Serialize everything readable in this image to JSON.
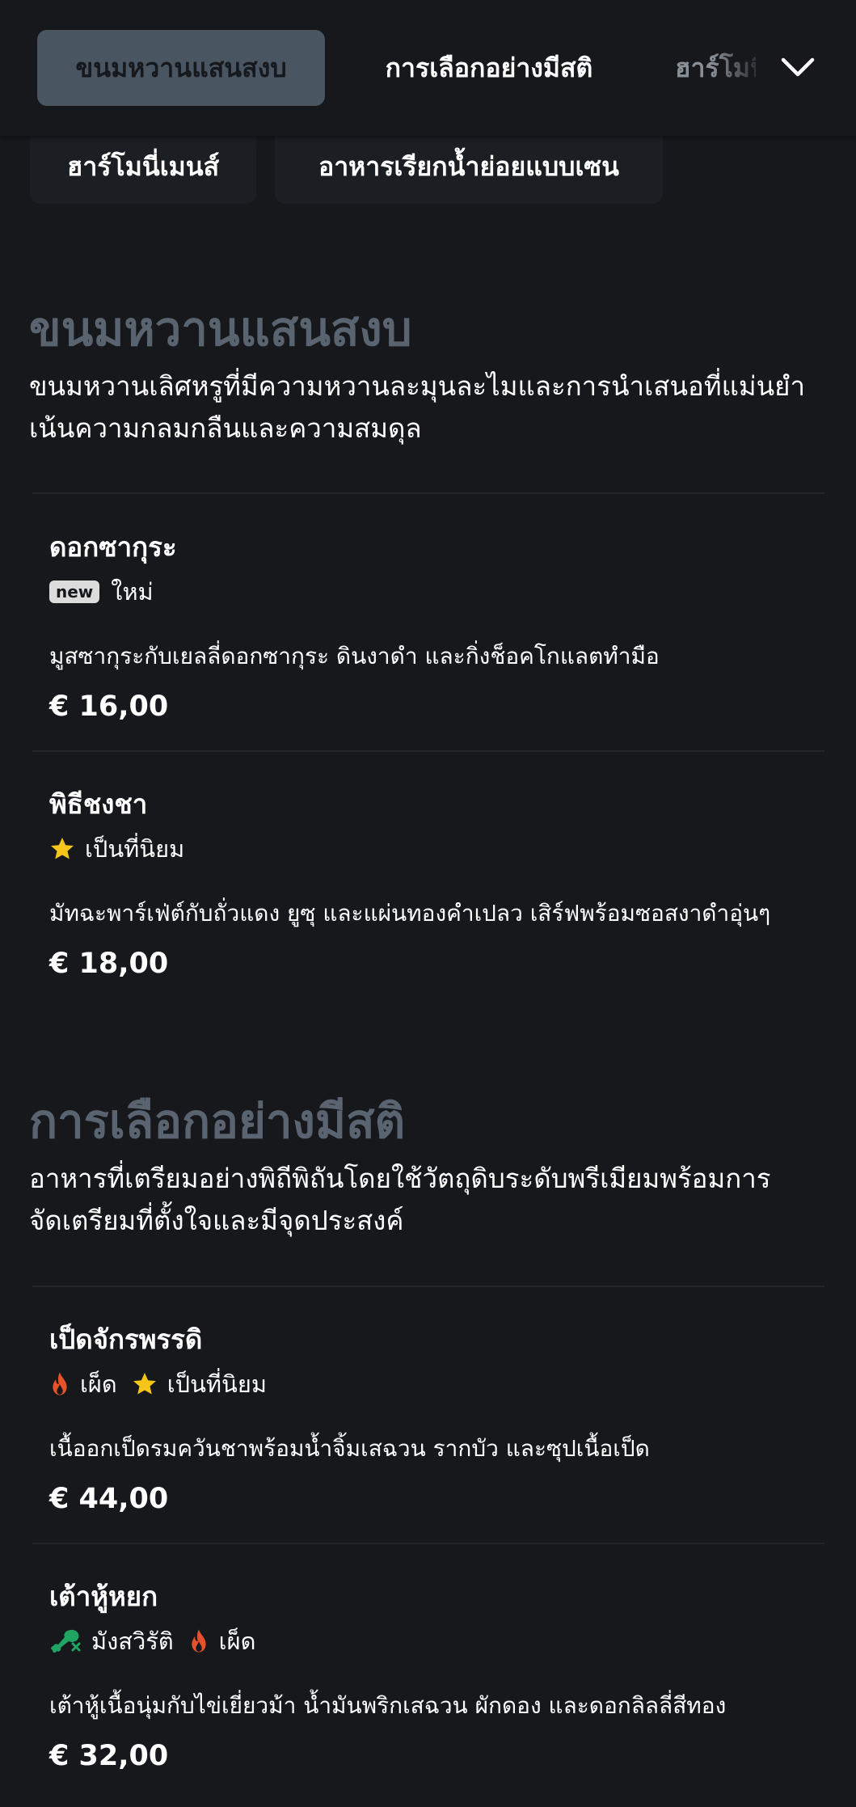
{
  "nav": {
    "tabs": [
      {
        "label": "ขนมหวานแสนสงบ"
      },
      {
        "label": "การเลือกอย่างมีสติ"
      },
      {
        "label": "ฮาร์โมนี่เมนส์"
      }
    ],
    "chips": [
      {
        "label": "ฮาร์โมนี่เมนส์"
      },
      {
        "label": "อาหารเรียกน้ำย่อยแบบเซน"
      }
    ]
  },
  "sections": [
    {
      "title": "ขนมหวานแสนสงบ",
      "desc_line1": "ขนมหวานเลิศหรูที่มีความหวานละมุนละไมและการนำเสนอที่แม่นยำ",
      "desc_line2": "เน้นความกลมกลืนและความสมดุล",
      "items": [
        {
          "name": "ดอกซากุระ",
          "badge": "new",
          "tag_new": "ใหม่",
          "description": "มูสซากุระกับเยลลี่ดอกซากุระ ดินงาดำ และกิ่งช็อคโกแลตทำมือ",
          "price": "€ 16,00"
        },
        {
          "name": "พิธีชงชา",
          "tag_popular": "เป็นที่นิยม",
          "description": "มัทฉะพาร์เฟ่ต์กับถั่วแดง ยูซุ และแผ่นทองคำเปลว เสิร์ฟพร้อมซอสงาดำอุ่นๆ",
          "price": "€ 18,00"
        }
      ]
    },
    {
      "title": "การเลือกอย่างมีสติ",
      "desc_line1": "อาหารที่เตรียมอย่างพิถีพิถันโดยใช้วัตถุดิบระดับพรีเมียมพร้อมการ",
      "desc_line2": "จัดเตรียมที่ตั้งใจและมีจุดประสงค์",
      "items": [
        {
          "name": "เป็ดจักรพรรดิ",
          "tag_spicy": "เผ็ด",
          "tag_popular": "เป็นที่นิยม",
          "description": "เนื้ออกเป็ดรมควันชาพร้อมน้ำจิ้มเสฉวน รากบัว และซุปเนื้อเป็ด",
          "price": "€ 44,00"
        },
        {
          "name": "เต้าหู้หยก",
          "tag_vegan": "มังสวิรัติ",
          "tag_spicy": "เผ็ด",
          "description": "เต้าหู้เนื้อนุ่มกับไข่เยี่ยวม้า น้ำมันพริกเสฉวน ผักดอง และดอกลิลลี่สีทอง",
          "price": "€ 32,00"
        }
      ]
    }
  ],
  "colors": {
    "background": "#16181c",
    "active_tab": "#4a5562",
    "section_title": "#5a6470",
    "star": "#f5c518",
    "flame": "#e8522a",
    "vegan": "#1fa463"
  },
  "icons": [
    "chevron-down-icon",
    "star-icon",
    "flame-icon",
    "vegan-drumstick-icon"
  ]
}
